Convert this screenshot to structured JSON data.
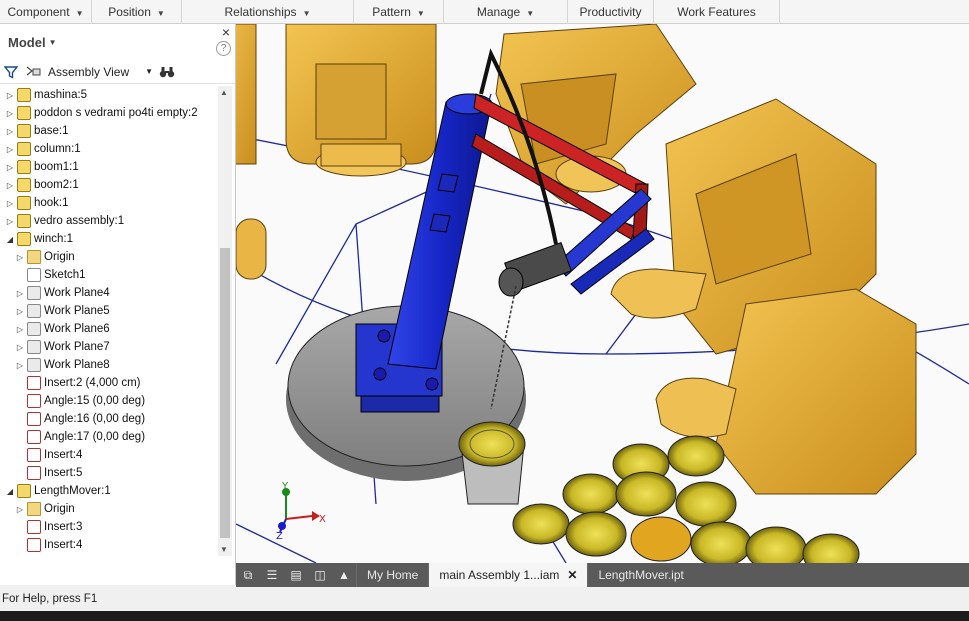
{
  "ribbon": {
    "tabs": [
      {
        "label": "Component",
        "dropdown": true,
        "width": 92
      },
      {
        "label": "Position",
        "dropdown": true,
        "width": 90
      },
      {
        "label": "Relationships",
        "dropdown": true,
        "width": 172
      },
      {
        "label": "Pattern",
        "dropdown": true,
        "width": 90
      },
      {
        "label": "Manage",
        "dropdown": true,
        "width": 124
      },
      {
        "label": "Productivity",
        "dropdown": false,
        "width": 86
      },
      {
        "label": "Work Features",
        "dropdown": false,
        "width": 126
      }
    ]
  },
  "browser": {
    "title": "Model",
    "close": "×",
    "help": "?",
    "view_label": "Assembly View",
    "items": [
      {
        "label": "mashina:5",
        "indent": 0,
        "arrow": "▷",
        "icon": "part"
      },
      {
        "label": "poddon s vedrami po4ti empty:2",
        "indent": 0,
        "arrow": "▷",
        "icon": "asm"
      },
      {
        "label": "base:1",
        "indent": 0,
        "arrow": "▷",
        "icon": "part"
      },
      {
        "label": "column:1",
        "indent": 0,
        "arrow": "▷",
        "icon": "part"
      },
      {
        "label": "boom1:1",
        "indent": 0,
        "arrow": "▷",
        "icon": "part"
      },
      {
        "label": "boom2:1",
        "indent": 0,
        "arrow": "▷",
        "icon": "part"
      },
      {
        "label": "hook:1",
        "indent": 0,
        "arrow": "▷",
        "icon": "part"
      },
      {
        "label": "vedro assembly:1",
        "indent": 0,
        "arrow": "▷",
        "icon": "asm"
      },
      {
        "label": "winch:1",
        "indent": 0,
        "arrow": "◢",
        "icon": "part"
      },
      {
        "label": "Origin",
        "indent": 1,
        "arrow": "▷",
        "icon": "folder"
      },
      {
        "label": "Sketch1",
        "indent": 1,
        "arrow": "",
        "icon": "sketch"
      },
      {
        "label": "Work Plane4",
        "indent": 1,
        "arrow": "▷",
        "icon": "plane"
      },
      {
        "label": "Work Plane5",
        "indent": 1,
        "arrow": "▷",
        "icon": "plane"
      },
      {
        "label": "Work Plane6",
        "indent": 1,
        "arrow": "▷",
        "icon": "plane"
      },
      {
        "label": "Work Plane7",
        "indent": 1,
        "arrow": "▷",
        "icon": "plane"
      },
      {
        "label": "Work Plane8",
        "indent": 1,
        "arrow": "▷",
        "icon": "plane"
      },
      {
        "label": "Insert:2 (4,000 cm)",
        "indent": 1,
        "arrow": "",
        "icon": "constraint"
      },
      {
        "label": "Angle:15 (0,00 deg)",
        "indent": 1,
        "arrow": "",
        "icon": "angle"
      },
      {
        "label": "Angle:16 (0,00 deg)",
        "indent": 1,
        "arrow": "",
        "icon": "angle"
      },
      {
        "label": "Angle:17 (0,00 deg)",
        "indent": 1,
        "arrow": "",
        "icon": "angle"
      },
      {
        "label": "Insert:4",
        "indent": 1,
        "arrow": "",
        "icon": "constraint"
      },
      {
        "label": "Insert:5",
        "indent": 1,
        "arrow": "",
        "icon": "constraint"
      },
      {
        "label": "LengthMover:1",
        "indent": 0,
        "arrow": "◢",
        "icon": "part"
      },
      {
        "label": "Origin",
        "indent": 1,
        "arrow": "▷",
        "icon": "folder"
      },
      {
        "label": "Insert:3",
        "indent": 1,
        "arrow": "",
        "icon": "constraint"
      },
      {
        "label": "Insert:4",
        "indent": 1,
        "arrow": "",
        "icon": "constraint"
      }
    ]
  },
  "viewport": {
    "axis_labels": {
      "x": "X",
      "y": "Y",
      "z": "Z"
    }
  },
  "doctabs": {
    "tabs": [
      {
        "label": "My Home",
        "active": false,
        "close": false
      },
      {
        "label": "main Assembly 1...iam",
        "active": true,
        "close": true
      },
      {
        "label": "LengthMover.ipt",
        "active": false,
        "close": false
      }
    ]
  },
  "status": {
    "text": "For Help, press F1"
  },
  "colors": {
    "machine_body": "#e8b13a",
    "column_blue": "#1f2fd6",
    "boom_red": "#c42222",
    "bucket_yellow": "#d8cc2a",
    "base_gray": "#9a9a9a"
  }
}
